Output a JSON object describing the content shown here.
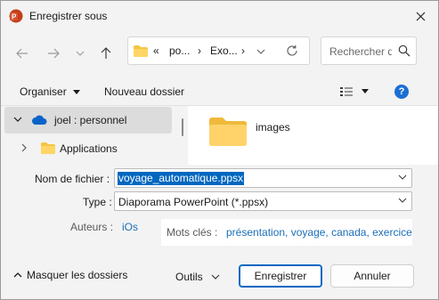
{
  "window": {
    "title": "Enregistrer sous",
    "accent_color": "#0067c0"
  },
  "address_bar": {
    "crumbs": [
      "«",
      "po...",
      "›",
      "Exo...",
      "›"
    ]
  },
  "search": {
    "placeholder": "Rechercher dans"
  },
  "toolbar": {
    "organize_label": "Organiser",
    "new_folder_label": "Nouveau dossier",
    "help_label": "?"
  },
  "navigation_tree": {
    "items": [
      {
        "label": "joel : personnel",
        "selected": true,
        "icon": "cloud-icon"
      },
      {
        "label": "Applications",
        "selected": false,
        "icon": "folder-icon"
      }
    ]
  },
  "content": {
    "items": [
      {
        "label": "images",
        "icon": "folder-icon"
      }
    ]
  },
  "form": {
    "filename_label": "Nom de fichier :",
    "filename_value": "voyage_automatique.ppsx",
    "type_label": "Type :",
    "type_value": "Diaporama PowerPoint (*.ppsx)",
    "authors_label": "Auteurs :",
    "authors_value": "iOs",
    "keywords_label": "Mots clés :",
    "keywords_value": "présentation, voyage, canada, exercice"
  },
  "footer": {
    "hide_folders_label": "Masquer les dossiers",
    "tools_label": "Outils",
    "save_label": "Enregistrer",
    "cancel_label": "Annuler"
  }
}
